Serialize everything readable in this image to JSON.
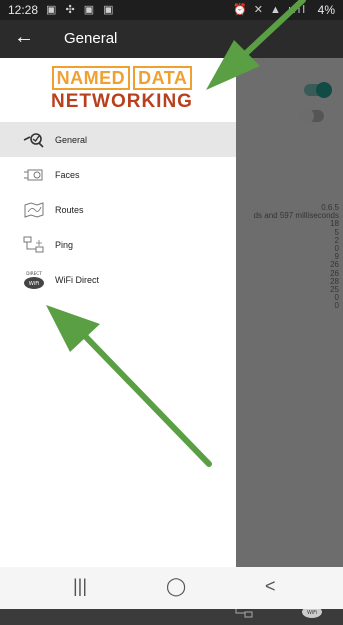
{
  "status_bar": {
    "time": "12:28",
    "left_icons": "▣ ✣ ▣ ▣",
    "right_icons": "⏰ ✕ ▲ ılıl",
    "battery": "4%"
  },
  "app_bar": {
    "title": "General",
    "back_icon": "arrow-back-icon"
  },
  "logo": {
    "word1": "NAMED",
    "word2": "DATA",
    "word3": "NETWORKING"
  },
  "background": {
    "stats": [
      "0.6.5",
      "ds and 597 milliseconds",
      "18",
      "5",
      "2",
      "0",
      "9",
      "26",
      "26",
      "28",
      "25",
      "0",
      "0"
    ]
  },
  "drawer": {
    "items": [
      {
        "label": "General",
        "icon": "general-icon",
        "selected": true
      },
      {
        "label": "Faces",
        "icon": "faces-icon",
        "selected": false
      },
      {
        "label": "Routes",
        "icon": "routes-icon",
        "selected": false
      },
      {
        "label": "Ping",
        "icon": "ping-icon",
        "selected": false
      },
      {
        "label": "WiFi Direct",
        "icon": "wifi-direct-icon",
        "selected": false
      }
    ]
  },
  "wifi_icon_text": {
    "top": "DIRECT",
    "bottom": "WiFi"
  },
  "nav_bar": {
    "recents": "|||",
    "home": "◯",
    "back": "<"
  },
  "colors": {
    "accent": "#26a69a",
    "annotation_arrow": "#5a9f43",
    "logo_orange": "#f0a030",
    "logo_red": "#b8401e"
  }
}
